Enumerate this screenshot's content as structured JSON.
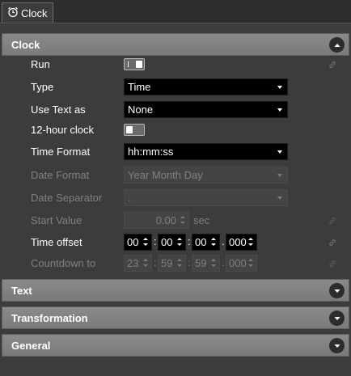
{
  "window": {
    "tab_label": "Clock",
    "tab_icon": "alarm-clock-icon"
  },
  "sections": {
    "clock": {
      "title": "Clock",
      "expanded": true
    },
    "text": {
      "title": "Text"
    },
    "transformation": {
      "title": "Transformation"
    },
    "general": {
      "title": "General"
    }
  },
  "properties": {
    "run": {
      "label": "Run",
      "value": "on"
    },
    "type": {
      "label": "Type",
      "value": "Time"
    },
    "use_text_as": {
      "label": "Use Text as",
      "value": "None"
    },
    "twelve_hour": {
      "label": "12-hour clock",
      "value": "off"
    },
    "time_format": {
      "label": "Time Format",
      "value": "hh:mm:ss"
    },
    "date_format": {
      "label": "Date Format",
      "value": "Year Month Day"
    },
    "date_separator": {
      "label": "Date Separator",
      "value": "."
    },
    "start_value": {
      "label": "Start Value",
      "value": "0.00",
      "unit": "sec"
    },
    "time_offset": {
      "label": "Time offset",
      "hh": "00",
      "mm": "00",
      "ss": "00",
      "ms": "000"
    },
    "countdown_to": {
      "label": "Countdown to",
      "hh": "23",
      "mm": "59",
      "ss": "59",
      "ms": "000"
    }
  },
  "colors": {
    "background": "#3c3c3c",
    "header": "#808080",
    "field": "#000000",
    "disabled_text": "#808080"
  }
}
